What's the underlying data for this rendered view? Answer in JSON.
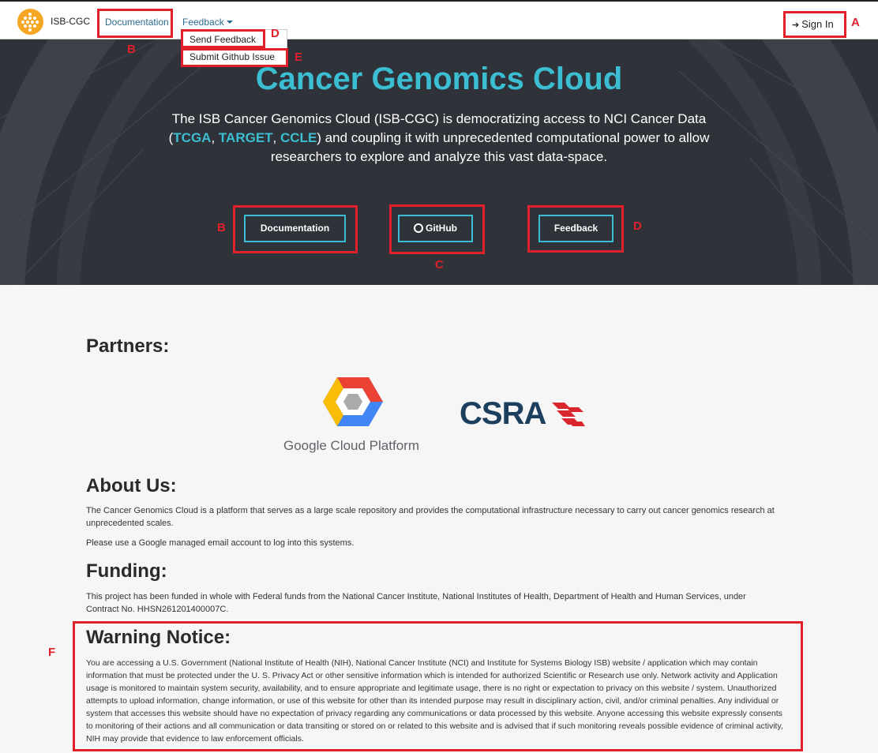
{
  "navbar": {
    "brand": "ISB-CGC",
    "documentation": "Documentation",
    "feedback": "Feedback",
    "sign_in": "Sign In"
  },
  "feedback_menu": {
    "send_feedback": "Send Feedback",
    "submit_github_issue": "Submit Github Issue"
  },
  "hero": {
    "title": "Cancer Genomics Cloud",
    "desc_before": "The ISB Cancer Genomics Cloud (ISB-CGC) is democratizing access to NCI Cancer Data (",
    "link_tcga": "TCGA",
    "link_target": "TARGET",
    "link_ccle": "CCLE",
    "desc_after": ") and coupling it with unprecedented computational power to allow researchers to explore and analyze this vast data-space.",
    "btn_documentation": "Documentation",
    "btn_github": "GitHub",
    "btn_feedback": "Feedback"
  },
  "partners": {
    "heading": "Partners:",
    "google": "Google Cloud Platform",
    "csra": "CSRA"
  },
  "about": {
    "heading": "About Us:",
    "p1": "The Cancer Genomics Cloud is a platform that serves as a large scale repository and provides the computational infrastructure necessary to carry out cancer genomics research at unprecedented scales.",
    "p2": "Please use a Google managed email account to log into this systems."
  },
  "funding": {
    "heading": "Funding:",
    "p1": "This project has been funded in whole with Federal funds from the National Cancer Institute, National Institutes of Health, Department of Health and Human Services, under Contract No. HHSN261201400007C."
  },
  "warning": {
    "heading": "Warning Notice:",
    "p1": "You are accessing a U.S. Government (National Institute of Health (NIH), National Cancer Institute (NCI) and Institute for Systems Biology ISB) website / application which may contain information that must be protected under the U. S. Privacy Act or other sensitive information which is intended for authorized Scientific or Research use only. Network activity and Application usage is monitored to maintain system security, availability, and to ensure appropriate and legitimate usage, there is no right or expectation to privacy on this website / system. Unauthorized attempts to upload information, change information, or use of this website for other than its intended purpose may result in disciplinary action, civil, and/or criminal penalties. Any individual or system that accesses this website should have no expectation of privacy regarding any communications or data processed by this website. Anyone accessing this website expressly consents to monitoring of their actions and all communication or data transiting or stored on or related to this website and is advised that if such monitoring reveals possible evidence of criminal activity, NIH may provide that evidence to law enforcement officials."
  },
  "annotations": {
    "a": "A",
    "b": "B",
    "c": "C",
    "d": "D",
    "e": "E",
    "f": "F"
  },
  "colors": {
    "accent": "#3bbdd2",
    "hero_bg": "#2f3238",
    "annotation": "#e0212b"
  }
}
